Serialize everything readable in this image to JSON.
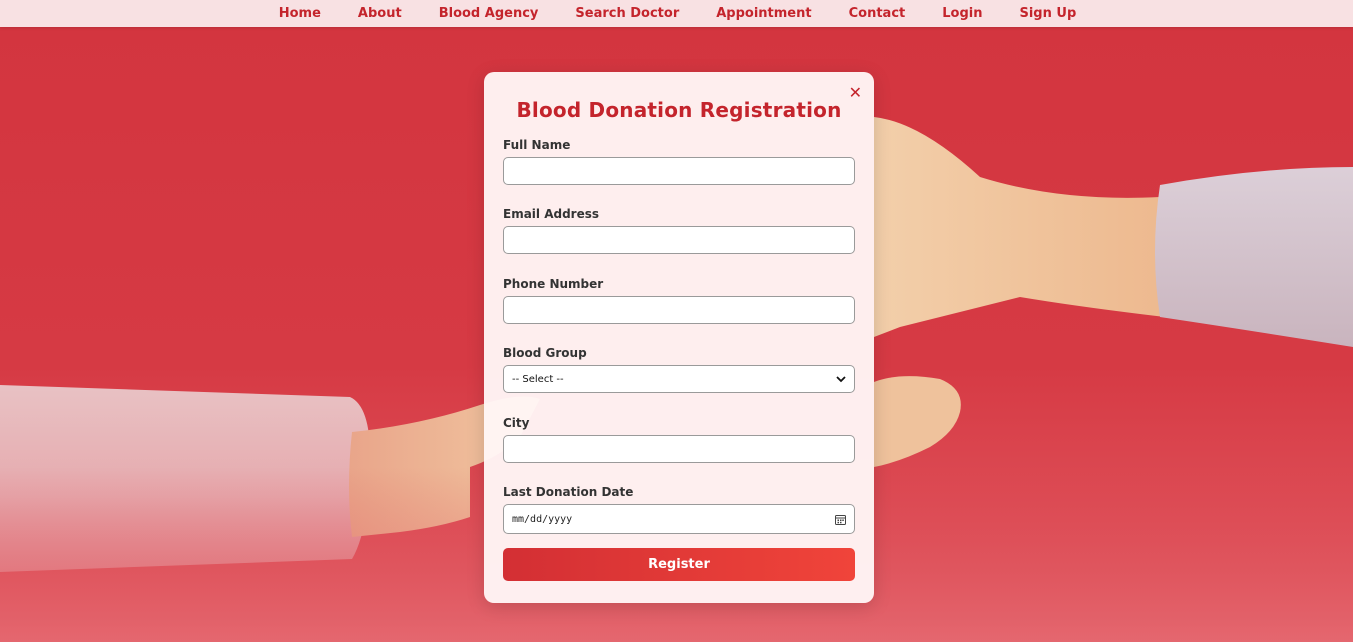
{
  "nav": {
    "items": [
      {
        "label": "Home"
      },
      {
        "label": "About"
      },
      {
        "label": "Blood Agency"
      },
      {
        "label": "Search Doctor"
      },
      {
        "label": "Appointment"
      },
      {
        "label": "Contact"
      },
      {
        "label": "Login"
      },
      {
        "label": "Sign Up"
      }
    ]
  },
  "modal": {
    "title": "Blood Donation Registration",
    "close_label": "✕",
    "fields": {
      "full_name": {
        "label": "Full Name",
        "value": ""
      },
      "email": {
        "label": "Email Address",
        "value": ""
      },
      "phone": {
        "label": "Phone Number",
        "value": ""
      },
      "blood_group": {
        "label": "Blood Group",
        "selected": "-- Select --"
      },
      "city": {
        "label": "City",
        "value": ""
      },
      "last_donation": {
        "label": "Last Donation Date",
        "placeholder": "mm/dd/yyyy"
      }
    },
    "submit_label": "Register"
  },
  "colors": {
    "accent": "#c4242c",
    "nav_bg": "#f8e1e3",
    "page_bg": "#d4343f",
    "button_start": "#d32f34",
    "button_end": "#f0443a"
  },
  "icons": {
    "close": "close-icon",
    "select": "chevron-down-icon",
    "date": "calendar-icon"
  }
}
